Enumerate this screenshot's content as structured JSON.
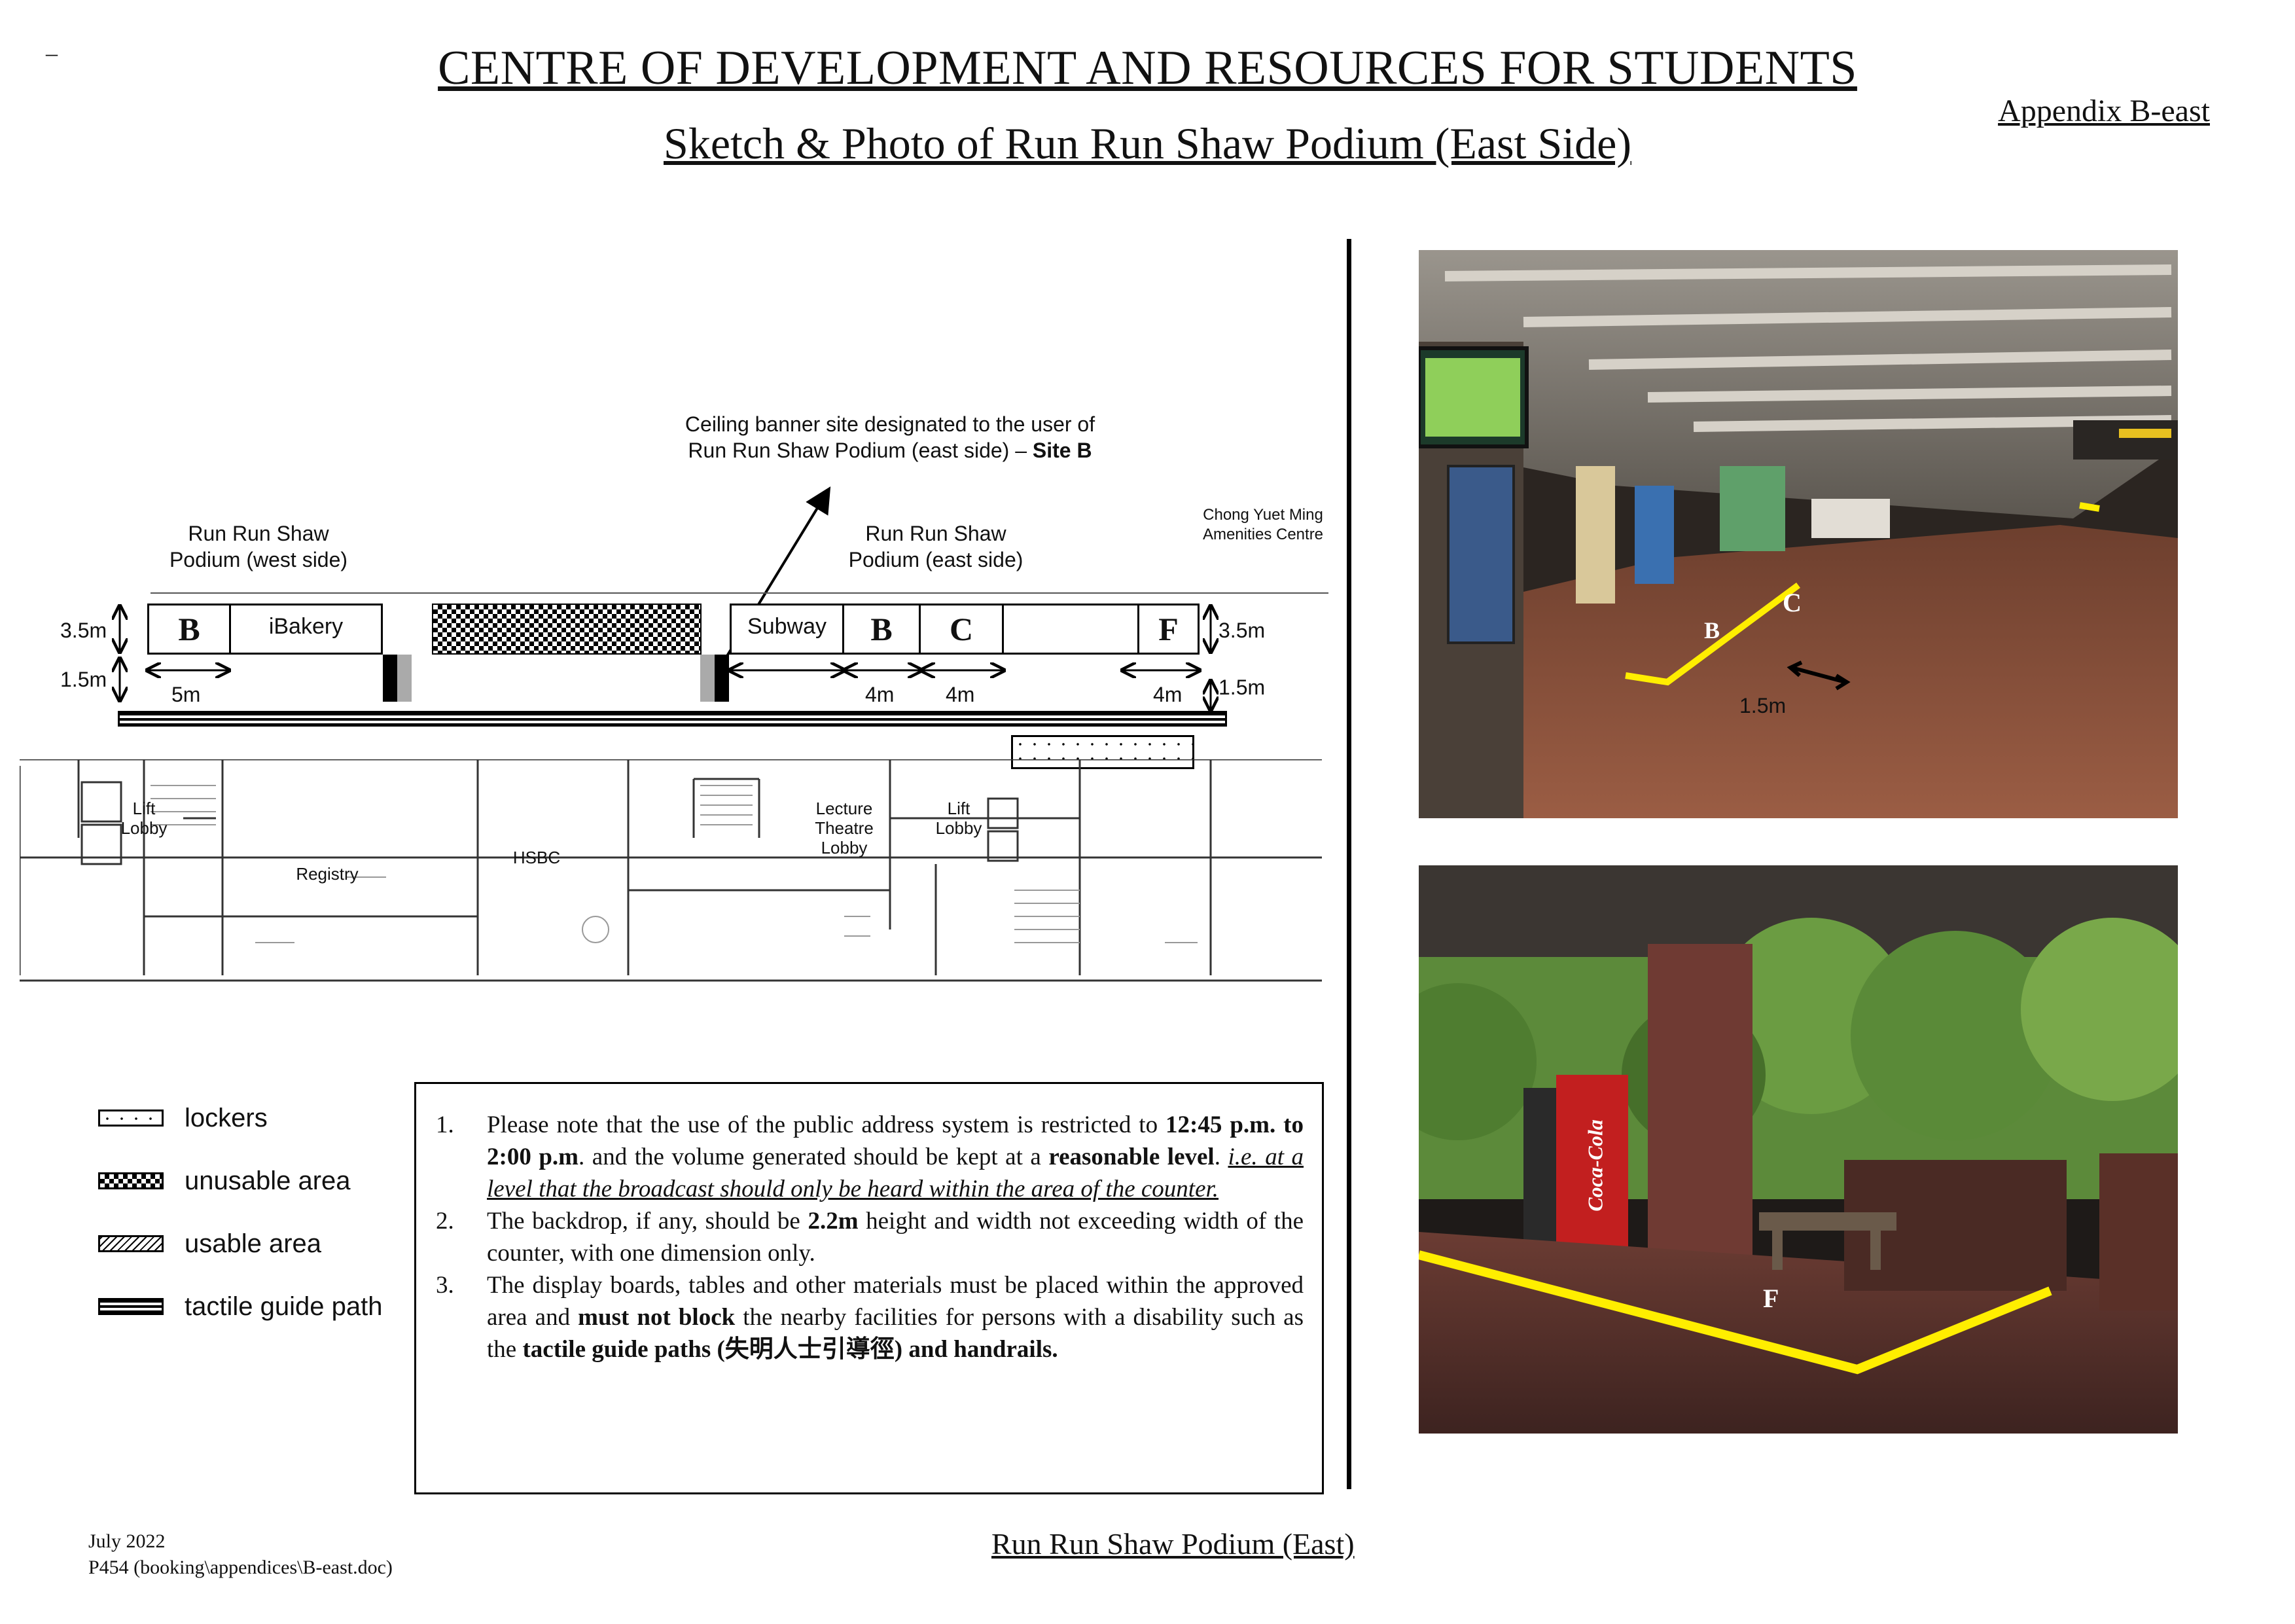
{
  "header": {
    "title": "CENTRE OF DEVELOPMENT AND RESOURCES FOR STUDENTS",
    "subtitle": "Sketch & Photo of Run Run Shaw Podium (East Side)",
    "appendix": "Appendix B-east",
    "dash": "–"
  },
  "plan": {
    "banner_note_line1": "Ceiling banner site designated to the user of",
    "banner_note_line2": "Run Run Shaw Podium (east side) –",
    "banner_note_site": "Site B",
    "west_label_1": "Run Run Shaw",
    "west_label_2": "Podium (west side)",
    "east_label_1": "Run Run Shaw",
    "east_label_2": "Podium (east side)",
    "cym_1": "Chong Yuet Ming",
    "cym_2": "Amenities Centre",
    "boxes": {
      "b_west": "B",
      "ibakery": "iBakery",
      "subway": "Subway",
      "b_east": "B",
      "c": "C",
      "f": "F"
    },
    "dims": {
      "h_left_top": "3.5m",
      "h_left_bottom": "1.5m",
      "w_b_west": "5m",
      "w_b_east": "4m",
      "w_c": "4m",
      "w_f": "4m",
      "h_right_top": "3.5m",
      "h_right_bottom": "1.5m"
    },
    "rooms": {
      "lift_lobby_1": "Lift\nLobby",
      "registry": "Registry",
      "hsbc": "HSBC",
      "lecture_lobby": "Lecture\nTheatre\nLobby",
      "lift_lobby_2": "Lift\nLobby"
    }
  },
  "legend": [
    {
      "pattern": "dots",
      "label": "lockers"
    },
    {
      "pattern": "checker",
      "label": "unusable area"
    },
    {
      "pattern": "hatch",
      "label": "usable area"
    },
    {
      "pattern": "tactile",
      "label": "tactile guide path"
    }
  ],
  "notes": {
    "n1": "1.",
    "n1_a": "Please note that the use of the public address system is restricted to",
    "n1_b": "12:45 p.m. to 2:00 p.m",
    "n1_c": ". and the volume generated should be kept at a",
    "n1_d": "reasonable level",
    "n1_e": ".",
    "n1_f": "i.e. at a level that the broadcast should only be heard within the area of the counter.",
    "n2": "2.",
    "n2_a": "The backdrop, if any, should be",
    "n2_b": "2.2m",
    "n2_c": "height and width not exceeding width of the counter, with one dimension only.",
    "n3": "3.",
    "n3_a": "The display boards, tables and other materials must be placed within the approved area and",
    "n3_b": "must not block",
    "n3_c": "the nearby facilities for persons with a disability such as the",
    "n3_d": "tactile guide paths (失明人士引導徑) and handrails."
  },
  "photos": {
    "top_labels": {
      "c": "C",
      "b": "B",
      "dim": "1.5m"
    },
    "bottom_labels": {
      "f": "F"
    },
    "coca_cola": "Coca-Cola"
  },
  "footer": {
    "date": "July 2022",
    "ref": "P454 (booking\\appendices\\B-east.doc)",
    "caption": "Run Run Shaw Podium (East)"
  },
  "colors": {
    "highlight": "#ffee00",
    "brick": "#7a4a3a",
    "ceiling": "#cfcac2"
  }
}
